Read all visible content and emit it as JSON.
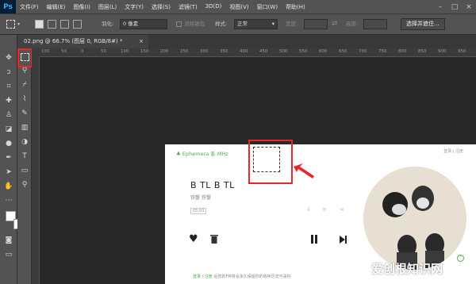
{
  "app": {
    "logo": "Ps"
  },
  "menu": [
    "文件(F)",
    "编辑(E)",
    "图像(I)",
    "图层(L)",
    "文字(Y)",
    "选择(S)",
    "滤镜(T)",
    "3D(D)",
    "视图(V)",
    "窗口(W)",
    "帮助(H)"
  ],
  "options_bar": {
    "feather_label": "羽化:",
    "feather_value": "0 像素",
    "antialias_label": "消除锯齿",
    "style_label": "样式:",
    "style_value": "正常",
    "width_label": "宽度:",
    "height_label": "高度:",
    "select_mask_button": "选择并遮住..."
  },
  "document_tab": {
    "label": "02.png @ 66.7% (图层 0, RGB/8#) *",
    "close": "×"
  },
  "ruler_ticks": [
    "100",
    "50",
    "0",
    "50",
    "100",
    "150",
    "200",
    "250",
    "300",
    "350",
    "400",
    "450",
    "500",
    "550",
    "600",
    "650",
    "700",
    "750",
    "800",
    "850",
    "900",
    "950"
  ],
  "document": {
    "brand": "Ephemera 系 MHz",
    "top_right": "登录 | 注册",
    "song_title": "B TL B TL",
    "artist": "铁蟹 铁蟹",
    "tag": "05:03",
    "footer_login": "登录",
    "footer_sep": " / ",
    "footer_register": "注册",
    "footer_text": "后您的FM将会永久保留你的收听历史与喜好"
  },
  "watermark": "爱创根知识网",
  "colors": {
    "highlight": "#e8262c",
    "brand_green": "#4caf50",
    "ps_blue": "#31a8ff"
  }
}
